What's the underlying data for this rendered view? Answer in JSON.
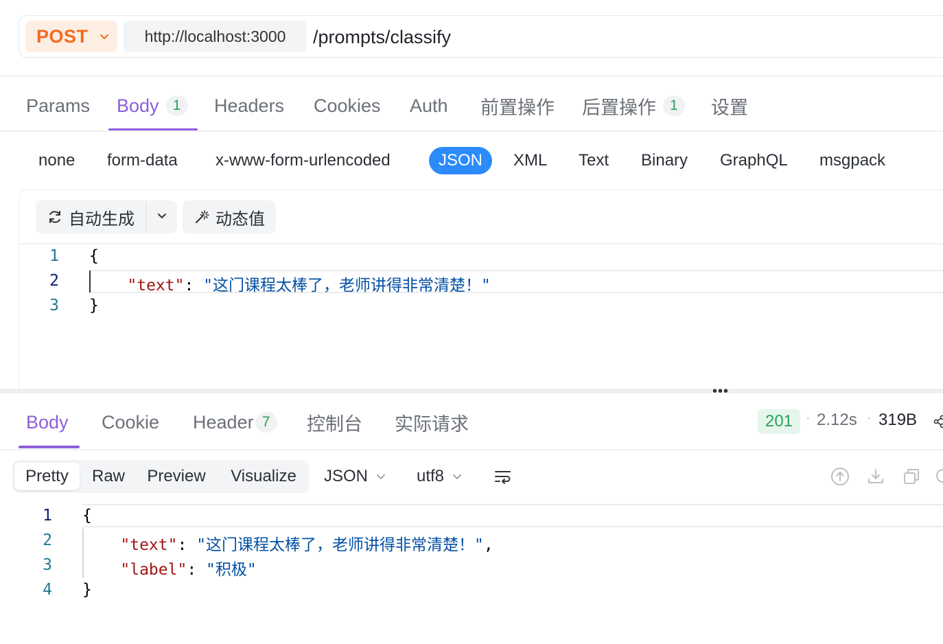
{
  "request": {
    "method": "POST",
    "base_url": "http://localhost:3000",
    "path": "/prompts/classify"
  },
  "request_tabs": [
    {
      "label": "Params"
    },
    {
      "label": "Body",
      "badge": "1"
    },
    {
      "label": "Headers"
    },
    {
      "label": "Cookies"
    },
    {
      "label": "Auth"
    },
    {
      "label": "前置操作"
    },
    {
      "label": "后置操作",
      "badge": "1"
    },
    {
      "label": "设置"
    }
  ],
  "body_types": [
    "none",
    "form-data",
    "x-www-form-urlencoded",
    "JSON",
    "XML",
    "Text",
    "Binary",
    "GraphQL",
    "msgpack"
  ],
  "editor_toolbar": {
    "auto_generate": "自动生成",
    "dynamic_value": "动态值"
  },
  "request_body": {
    "line_numbers": [
      "1",
      "2",
      "3"
    ],
    "open_brace": "{",
    "key": "\"text\"",
    "colon": ": ",
    "value": "\"这门课程太棒了，老师讲得非常清楚！\"",
    "close_brace": "}"
  },
  "response_tabs": [
    {
      "label": "Body"
    },
    {
      "label": "Cookie"
    },
    {
      "label": "Header",
      "badge": "7"
    },
    {
      "label": "控制台"
    },
    {
      "label": "实际请求"
    }
  ],
  "response_meta": {
    "status": "201",
    "time": "2.12s",
    "size": "319B"
  },
  "response_toolbar": {
    "views": [
      "Pretty",
      "Raw",
      "Preview",
      "Visualize"
    ],
    "format": "JSON",
    "encoding": "utf8"
  },
  "response_body": {
    "line_numbers": [
      "1",
      "2",
      "3",
      "4"
    ],
    "open_brace": "{",
    "text_key": "\"text\"",
    "text_value": "\"这门课程太棒了，老师讲得非常清楚！\"",
    "label_key": "\"label\"",
    "label_value": "\"积极\"",
    "colon": ": ",
    "comma": ",",
    "close_brace": "}"
  },
  "colors": {
    "accent": "#8e5ddb",
    "method": "#f26c1e",
    "json_active": "#2c8bfa",
    "success": "#27a15a"
  }
}
